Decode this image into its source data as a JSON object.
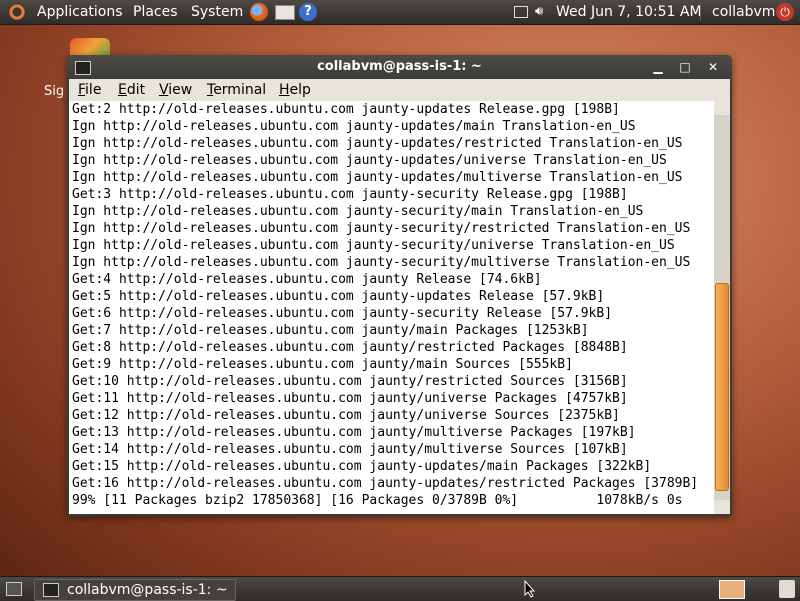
{
  "top_panel": {
    "menus": [
      "Applications",
      "Places",
      "System"
    ],
    "datetime": "Wed Jun  7, 10:51 AM",
    "user": "collabvm",
    "icons": [
      "ubuntu-logo-icon",
      "firefox-icon",
      "mail-icon",
      "help-icon",
      "window-icon",
      "volume-icon",
      "power-icon"
    ]
  },
  "desktop": {
    "icon_label": "Sig"
  },
  "window": {
    "title": "collabvm@pass-is-1: ~",
    "menu": [
      "File",
      "Edit",
      "View",
      "Terminal",
      "Help"
    ],
    "lines": [
      "Get:2 http://old-releases.ubuntu.com jaunty-updates Release.gpg [198B]",
      "Ign http://old-releases.ubuntu.com jaunty-updates/main Translation-en_US",
      "Ign http://old-releases.ubuntu.com jaunty-updates/restricted Translation-en_US",
      "Ign http://old-releases.ubuntu.com jaunty-updates/universe Translation-en_US",
      "Ign http://old-releases.ubuntu.com jaunty-updates/multiverse Translation-en_US",
      "Get:3 http://old-releases.ubuntu.com jaunty-security Release.gpg [198B]",
      "Ign http://old-releases.ubuntu.com jaunty-security/main Translation-en_US",
      "Ign http://old-releases.ubuntu.com jaunty-security/restricted Translation-en_US",
      "Ign http://old-releases.ubuntu.com jaunty-security/universe Translation-en_US",
      "Ign http://old-releases.ubuntu.com jaunty-security/multiverse Translation-en_US",
      "Get:4 http://old-releases.ubuntu.com jaunty Release [74.6kB]",
      "Get:5 http://old-releases.ubuntu.com jaunty-updates Release [57.9kB]",
      "Get:6 http://old-releases.ubuntu.com jaunty-security Release [57.9kB]",
      "Get:7 http://old-releases.ubuntu.com jaunty/main Packages [1253kB]",
      "Get:8 http://old-releases.ubuntu.com jaunty/restricted Packages [8848B]",
      "Get:9 http://old-releases.ubuntu.com jaunty/main Sources [555kB]",
      "Get:10 http://old-releases.ubuntu.com jaunty/restricted Sources [3156B]",
      "Get:11 http://old-releases.ubuntu.com jaunty/universe Packages [4757kB]",
      "Get:12 http://old-releases.ubuntu.com jaunty/universe Sources [2375kB]",
      "Get:13 http://old-releases.ubuntu.com jaunty/multiverse Packages [197kB]",
      "Get:14 http://old-releases.ubuntu.com jaunty/multiverse Sources [107kB]",
      "Get:15 http://old-releases.ubuntu.com jaunty-updates/main Packages [322kB]",
      "Get:16 http://old-releases.ubuntu.com jaunty-updates/restricted Packages [3789B]",
      "99% [11 Packages bzip2 17850368] [16 Packages 0/3789B 0%]          1078kB/s 0s"
    ]
  },
  "bottom_panel": {
    "task_label": "collabvm@pass-is-1: ~"
  },
  "colors": {
    "accent": "#e58b2c",
    "panel": "#3a3733",
    "terminal_bg": "#ffffff"
  }
}
